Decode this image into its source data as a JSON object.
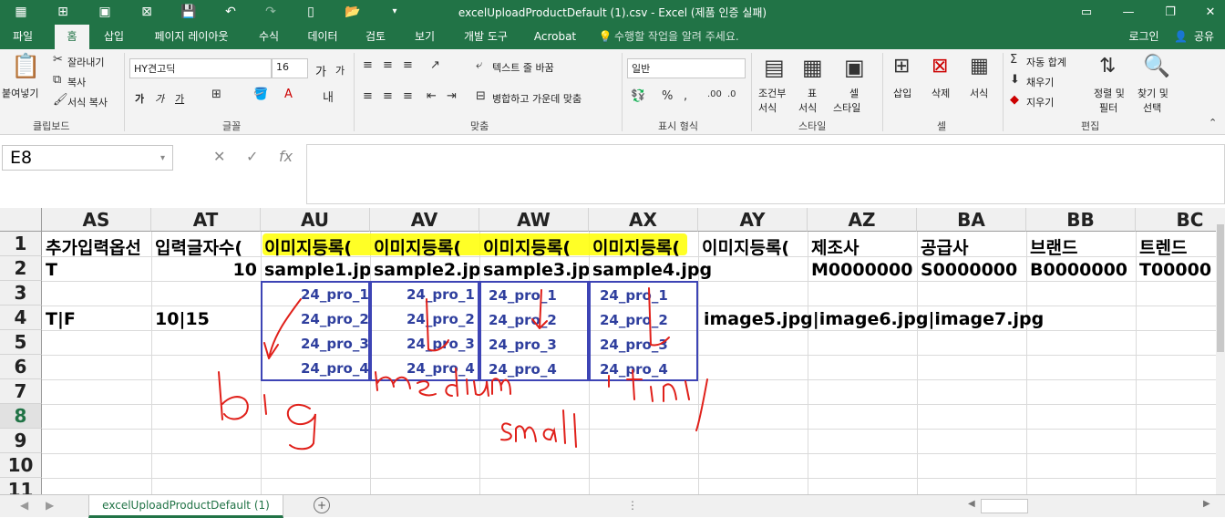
{
  "window": {
    "title": "excelUploadProductDefault (1).csv - Excel (제품 인증 실패)"
  },
  "tabs": [
    {
      "label": "파일"
    },
    {
      "label": "홈"
    },
    {
      "label": "삽입"
    },
    {
      "label": "페이지 레이아웃"
    },
    {
      "label": "수식"
    },
    {
      "label": "데이터"
    },
    {
      "label": "검토"
    },
    {
      "label": "보기"
    },
    {
      "label": "개발 도구"
    },
    {
      "label": "Acrobat"
    }
  ],
  "tell_me": "수행할 작업을 알려 주세요.",
  "account": {
    "login": "로그인",
    "share": "공유"
  },
  "ribbon": {
    "clipboard": {
      "paste": "붙여넣기",
      "cut": "잘라내기",
      "copy": "복사",
      "format_painter": "서식 복사",
      "label": "클립보드"
    },
    "font": {
      "name": "HY견고딕",
      "size": "16",
      "label": "글꼴",
      "bold": "가",
      "italic": "가",
      "underline": "가",
      "grow": "가",
      "shrink": "가"
    },
    "alignment": {
      "wrap": "텍스트 줄 바꿈",
      "merge": "병합하고 가운데 맞춤",
      "label": "맞춤"
    },
    "number": {
      "format": "일반",
      "label": "표시 형식"
    },
    "styles": {
      "conditional": "조건부",
      "conditional2": "서식",
      "table": "표",
      "table2": "서식",
      "cell": "셀",
      "cell2": "스타일",
      "label": "스타일"
    },
    "cells": {
      "insert": "삽입",
      "delete": "삭제",
      "format": "서식",
      "label": "셀"
    },
    "editing": {
      "autosum": "자동 합계",
      "fill": "채우기",
      "clear": "지우기",
      "sort": "정렬 및",
      "sort2": "필터",
      "find": "찾기 및",
      "find2": "선택",
      "label": "편집"
    }
  },
  "formula_bar": {
    "name_box": "E8",
    "fx": "fx",
    "value": ""
  },
  "columns": [
    "AS",
    "AT",
    "AU",
    "AV",
    "AW",
    "AX",
    "AY",
    "AZ",
    "BA",
    "BB",
    "BC"
  ],
  "rows": [
    "1",
    "2",
    "3",
    "4",
    "5",
    "6",
    "7",
    "8",
    "9",
    "10",
    "11"
  ],
  "cells": {
    "r1": [
      "추가입력옵선",
      "입력글자수(",
      "이미지등록(",
      "이미지등록(",
      "이미지등록(",
      "이미지등록(",
      "이미지등록(",
      "제조사",
      "공급사",
      "브랜드",
      "트렌드"
    ],
    "r2": [
      "T",
      "10",
      "sample1.jpg",
      "sample2.jpg",
      "sample3.jpg",
      "sample4.jpg",
      "",
      "M0000000",
      "S0000000",
      "B0000000",
      "T00000"
    ],
    "r4_as": "T|F",
    "r4_at": "10|15",
    "r4_ay": "image5.jpg|image6.jpg|image7.jpg"
  },
  "annotations": {
    "labels": [
      "24_pro_1",
      "24_pro_2",
      "24_pro_3",
      "24_pro_4"
    ],
    "handwritten": [
      "big",
      "medium",
      "small",
      "tiny"
    ],
    "ink_color": "#e0201a",
    "box_color": "#3d44b5"
  },
  "sheet": {
    "tab": "excelUploadProductDefault (1)",
    "add": "+"
  },
  "colors": {
    "excel_green": "#217346",
    "highlight": "#ffff00"
  }
}
